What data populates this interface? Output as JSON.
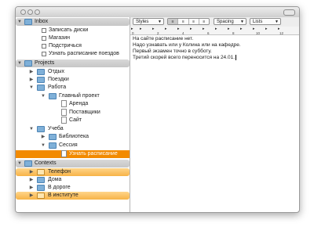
{
  "outline": {
    "inbox": {
      "label": "Inbox",
      "items": [
        "Записать диски",
        "Магазин",
        "Подстричься",
        "Узнать расписание поездов"
      ]
    },
    "projects": {
      "label": "Projects",
      "otdyh": "Отдых",
      "poezdki": "Поездки",
      "rabota": "Работа",
      "glavny": "Главный проект",
      "arenda": "Аренда",
      "postavshiki": "Поставщики",
      "sait": "Сайт",
      "ucheba": "Учеба",
      "biblioteka": "Библиотека",
      "sessiya": "Сессия",
      "selected": "Узнать расписание"
    },
    "contexts": {
      "label": "Contexts",
      "items": [
        "Телефон",
        "Дома",
        "В дороге",
        "В институте"
      ]
    }
  },
  "toolbar": {
    "styles": "Styles",
    "spacing": "Spacing",
    "lists": "Lists"
  },
  "ruler": {
    "ticks": [
      "0",
      "2",
      "4",
      "6",
      "8",
      "10",
      "12"
    ]
  },
  "editor": {
    "lines": [
      "На сайте расписание нет.",
      "Надо узнавать или у Колина или на кафедре.",
      "Первый экзамен точно в субботу.",
      "Третий скорей всего переносится на 24.01."
    ]
  }
}
